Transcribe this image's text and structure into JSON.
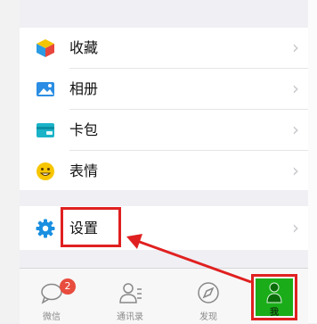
{
  "menu_group_1": {
    "items": [
      {
        "label": "收藏",
        "icon": "favorites-cube-icon"
      },
      {
        "label": "相册",
        "icon": "album-picture-icon"
      },
      {
        "label": "卡包",
        "icon": "card-wallet-icon"
      },
      {
        "label": "表情",
        "icon": "sticker-smiley-icon"
      }
    ]
  },
  "menu_group_2": {
    "items": [
      {
        "label": "设置",
        "icon": "settings-gear-icon"
      }
    ]
  },
  "tabbar": {
    "tabs": [
      {
        "label": "微信",
        "icon": "chat-bubble-icon",
        "badge": "2"
      },
      {
        "label": "通讯录",
        "icon": "contacts-icon"
      },
      {
        "label": "发现",
        "icon": "compass-icon"
      },
      {
        "label": "我",
        "icon": "person-icon",
        "active": true
      }
    ]
  },
  "colors": {
    "accent_green": "#1aad19",
    "annotation_red": "#e02020",
    "badge_red": "#e84c3d"
  }
}
